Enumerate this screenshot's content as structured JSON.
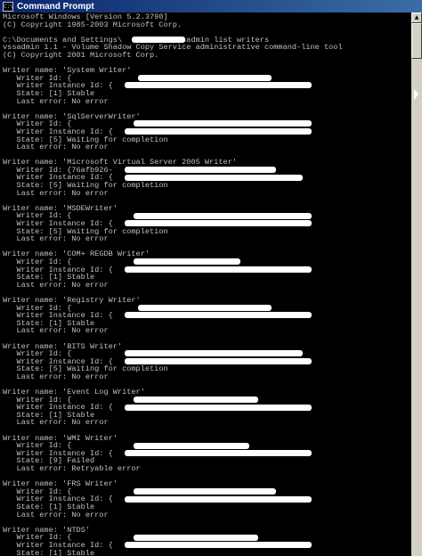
{
  "window": {
    "title": "Command Prompt",
    "icon": "cmd-icon"
  },
  "console": {
    "lines": [
      "Microsoft Windows [Version 5.2.3790]",
      "(C) Copyright 1985-2003 Microsoft Corp.",
      "",
      "C:\\Documents and Settings\\          >vssadmin list writers",
      "vssadmin 1.1 - Volume Shadow Copy Service administrative command-line tool",
      "(C) Copyright 2001 Microsoft Corp.",
      "",
      "Writer name: 'System Writer'",
      "   Writer Id: {",
      "   Writer Instance Id: {",
      "   State: [1] Stable",
      "   Last error: No error",
      "",
      "Writer name: 'SqlServerWriter'",
      "   Writer Id: {",
      "   Writer Instance Id: {",
      "   State: [5] Waiting for completion",
      "   Last error: No error",
      "",
      "Writer name: 'Microsoft Virtual Server 2005 Writer'",
      "   Writer Id: {76afb926-",
      "   Writer Instance Id: {",
      "   State: [5] Waiting for completion",
      "   Last error: No error",
      "",
      "Writer name: 'MSDEWriter'",
      "   Writer Id: {",
      "   Writer Instance Id: {",
      "   State: [5] Waiting for completion",
      "   Last error: No error",
      "",
      "Writer name: 'COM+ REGDB Writer'",
      "   Writer Id: {",
      "   Writer Instance Id: {",
      "   State: [1] Stable",
      "   Last error: No error",
      "",
      "Writer name: 'Registry Writer'",
      "   Writer Id: {",
      "   Writer Instance Id: {",
      "   State: [1] Stable",
      "   Last error: No error",
      "",
      "Writer name: 'BITS Writer'",
      "   Writer Id: {",
      "   Writer Instance Id: {",
      "   State: [5] Waiting for completion",
      "   Last error: No error",
      "",
      "Writer name: 'Event Log Writer'",
      "   Writer Id: {",
      "   Writer Instance Id: {",
      "   State: [1] Stable",
      "   Last error: No error",
      "",
      "Writer name: 'WMI Writer'",
      "   Writer Id: {",
      "   Writer Instance Id: {",
      "   State: [9] Failed",
      "   Last error: Retryable error",
      "",
      "Writer name: 'FRS Writer'",
      "   Writer Id: {",
      "   Writer Instance Id: {",
      "   State: [1] Stable",
      "   Last error: No error",
      "",
      "Writer name: 'NTDS'",
      "   Writer Id: {",
      "   Writer Instance Id: {",
      "   State: [1] Stable"
    ]
  },
  "scrollbar": {
    "up_icon": "arrow-up-icon",
    "down_icon": "arrow-down-icon"
  }
}
